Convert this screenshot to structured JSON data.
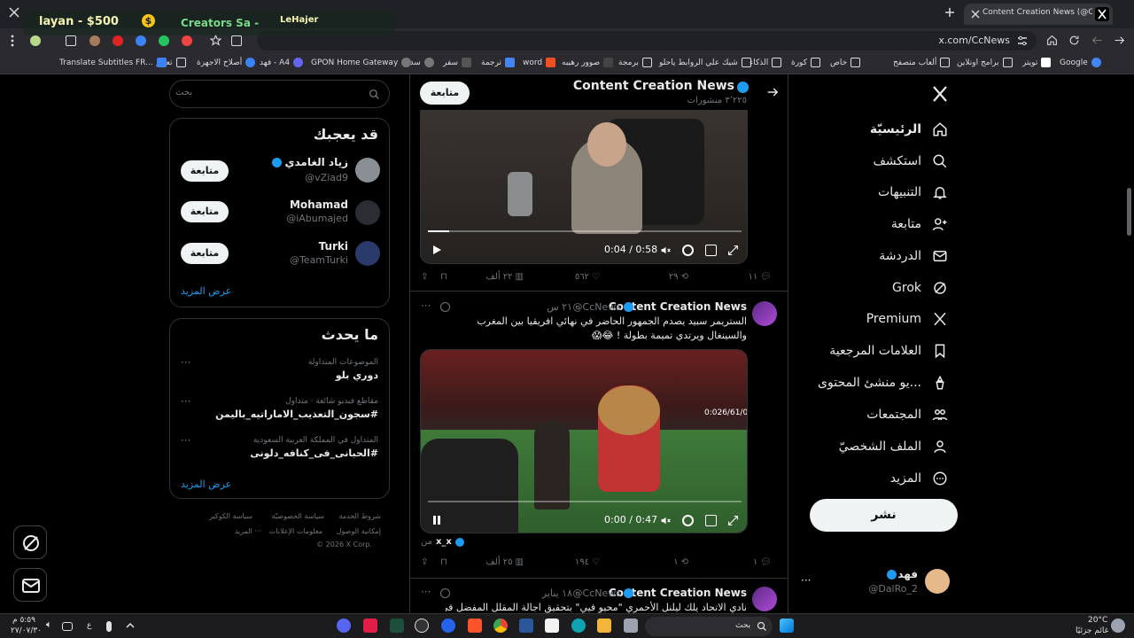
{
  "browser": {
    "tab_title": "Content Creation News (@CcNew",
    "url": "x.com/CcNews",
    "bookmarks": [
      "Google",
      "تويتر",
      "برامج اونلاين",
      "ألعاب متصفح",
      "خاص",
      "كورة",
      "الذكاء",
      "شيك علي الروابط ياحلو",
      "برمجة",
      "صوور رهيبه",
      "word",
      "ترجمة",
      "سفر",
      "سداد",
      "GPON Home Gateway",
      "فهد - A4",
      "أصلاح الاجهزة",
      "تعليم",
      "Translate Subtitles FR..."
    ]
  },
  "overlay": {
    "line1": "layan - $500",
    "line2": "Creators Sa -",
    "line3": "LeHajer"
  },
  "nav": {
    "items": [
      {
        "label": "الرئيسيّة",
        "icon": "home-icon"
      },
      {
        "label": "استكشف",
        "icon": "search-icon"
      },
      {
        "label": "التنبيهات",
        "icon": "bell-icon"
      },
      {
        "label": "متابعة",
        "icon": "follow-icon"
      },
      {
        "label": "الدردشة",
        "icon": "mail-icon"
      },
      {
        "label": "Grok",
        "icon": "grok-icon"
      },
      {
        "label": "Premium",
        "icon": "x-logo-icon"
      },
      {
        "label": "العلامات المرجعية",
        "icon": "bookmark-icon"
      },
      {
        "label": "...يو منشئ المحتوى",
        "icon": "creator-icon"
      },
      {
        "label": "المجتمعات",
        "icon": "communities-icon"
      },
      {
        "label": "الملف الشخصيّ",
        "icon": "profile-icon"
      },
      {
        "label": "المزيد",
        "icon": "more-icon"
      }
    ],
    "post_label": "نشر",
    "account": {
      "name": "فهد",
      "handle": "@DalRo_2"
    }
  },
  "profile_header": {
    "name": "Content Creation News",
    "posts_count": "٣٬٢٢٥ منشورات",
    "follow_label": "متابعة"
  },
  "tweets": [
    {
      "video_time": "0:04 / 0:58",
      "replies": "١١",
      "retweets": "٢٩",
      "likes": "٥٦٢",
      "views": "٢٢ ألف"
    },
    {
      "name": "Content Creation News",
      "handle": "@CcNews",
      "time": "· ٢١ س",
      "text": "الستريمر سبيد يصدم الجمهور الحاضر في نهائي افريقيا بين المغرب والسينغال ويرتدي تميمة بطولة ! 😂😱",
      "video_time": "0:00 / 0:47",
      "overlay_text": "0:026/61/0",
      "from_label": "من",
      "from_account": "x_x",
      "replies": "١",
      "retweets": "١",
      "likes": "١٩٤",
      "views": "٢٥ ألف"
    },
    {
      "name": "Content Creation News",
      "handle": "@CcNews",
      "time": "· ١٨ يناير",
      "text": "نادي الاتحاد يلك ليلنل الأحمري \"محيو فيي\" بتحقيق اجالة المقلل المفضل في"
    }
  ],
  "sidebar": {
    "search_placeholder": "بحث",
    "suggestions_title": "قد يعجبك",
    "suggestions": [
      {
        "name": "زياد الغامدي",
        "handle": "@vZiad9",
        "follow": "متابعة",
        "verified": true
      },
      {
        "name": "Mohamad",
        "handle": "@iAbumajed",
        "follow": "متابعة",
        "verified": false
      },
      {
        "name": "Turki",
        "handle": "@TeamTurki",
        "follow": "متابعة",
        "verified": false
      }
    ],
    "show_more": "عرض المزيد",
    "trends_title": "ما يحدث",
    "trends": [
      {
        "meta": "الموضوعات المتداولة",
        "title": "دوري بلو"
      },
      {
        "meta": "مقاطع فيديو شائعة · متداول",
        "title": "#سجون_التعذيب_الاماراتيه_باليمن"
      },
      {
        "meta": "المتداول في المملكة العربية السعودية",
        "title": "#الحبانى_فى_كنافه_دلونى"
      }
    ],
    "trends_more": "عرض المزيد",
    "footer": [
      "شروط الخدمة",
      "سياسة الخصوصيّة",
      "سياسة الكوكيز",
      "إمكانية الوصول",
      "معلومات الإعلانات",
      "··· المزيد",
      "© 2026 X Corp."
    ]
  },
  "taskbar": {
    "search_placeholder": "بحث",
    "weather_temp": "20°C",
    "weather_desc": "غائم جزئيًا",
    "time": "٥:٥٩ م",
    "date": "٢٧/٠٧/٣٠"
  },
  "colors": {
    "accent": "#1d9bf0",
    "background": "#000000",
    "text": "#e7e9ea",
    "muted": "#71767b",
    "border": "#2f3336"
  }
}
